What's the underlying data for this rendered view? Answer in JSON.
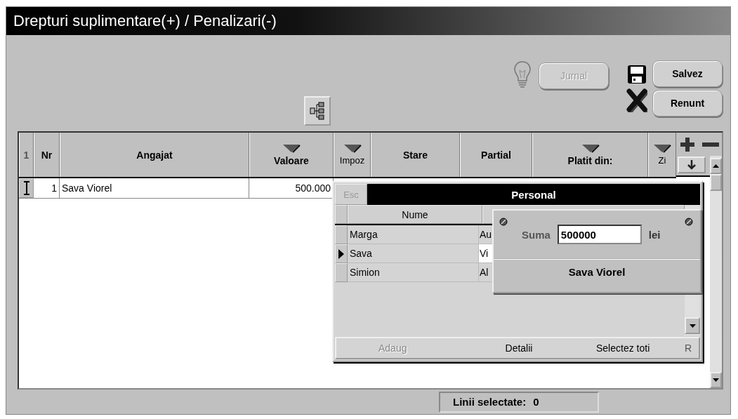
{
  "window": {
    "title": "Drepturi suplimentare(+) / Penalizari(-)"
  },
  "toolbar": {
    "buttons": [
      {
        "label": "Jurnal",
        "disabled": true
      },
      {
        "label": "Salvez",
        "disabled": false
      },
      {
        "label": "Renunt",
        "disabled": false
      }
    ]
  },
  "table": {
    "corner": "1",
    "columns": [
      {
        "label": "Nr",
        "sortable": false,
        "bold": true
      },
      {
        "label": "Angajat",
        "sortable": false,
        "bold": true
      },
      {
        "label": "Valoare",
        "sortable": true,
        "bold": true
      },
      {
        "label": "Impoz",
        "sortable": true,
        "bold": false
      },
      {
        "label": "Stare",
        "sortable": false,
        "bold": true
      },
      {
        "label": "Partial",
        "sortable": false,
        "bold": true
      },
      {
        "label": "Platit din:",
        "sortable": true,
        "bold": true
      },
      {
        "label": "Zi",
        "sortable": true,
        "bold": false
      }
    ],
    "rows": [
      {
        "nr": "1",
        "angajat": "Sava Viorel",
        "valoare": "500.000"
      }
    ]
  },
  "popup": {
    "title": "Personal",
    "esc": {
      "label": "Esc",
      "disabled": true
    },
    "columns": [
      "Nume"
    ],
    "rows": [
      {
        "column_1": "Marga",
        "column_2": "Au",
        "selected": false
      },
      {
        "column_1": "Sava",
        "column_2": "Vi",
        "selected": true
      },
      {
        "column_1": "Simion",
        "column_2": "Al",
        "selected": false
      }
    ],
    "footer": [
      {
        "label": "Adaug",
        "disabled": true
      },
      {
        "label": "Detalii",
        "disabled": false
      },
      {
        "label": "Selectez toti",
        "disabled": false
      },
      {
        "label": "R",
        "disabled": false
      }
    ]
  },
  "amount_dialog": {
    "label": "Suma",
    "value": "500000",
    "unit": "lei",
    "name": "Sava Viorel"
  },
  "status": {
    "label": "Linii selectate:",
    "value": "0"
  }
}
